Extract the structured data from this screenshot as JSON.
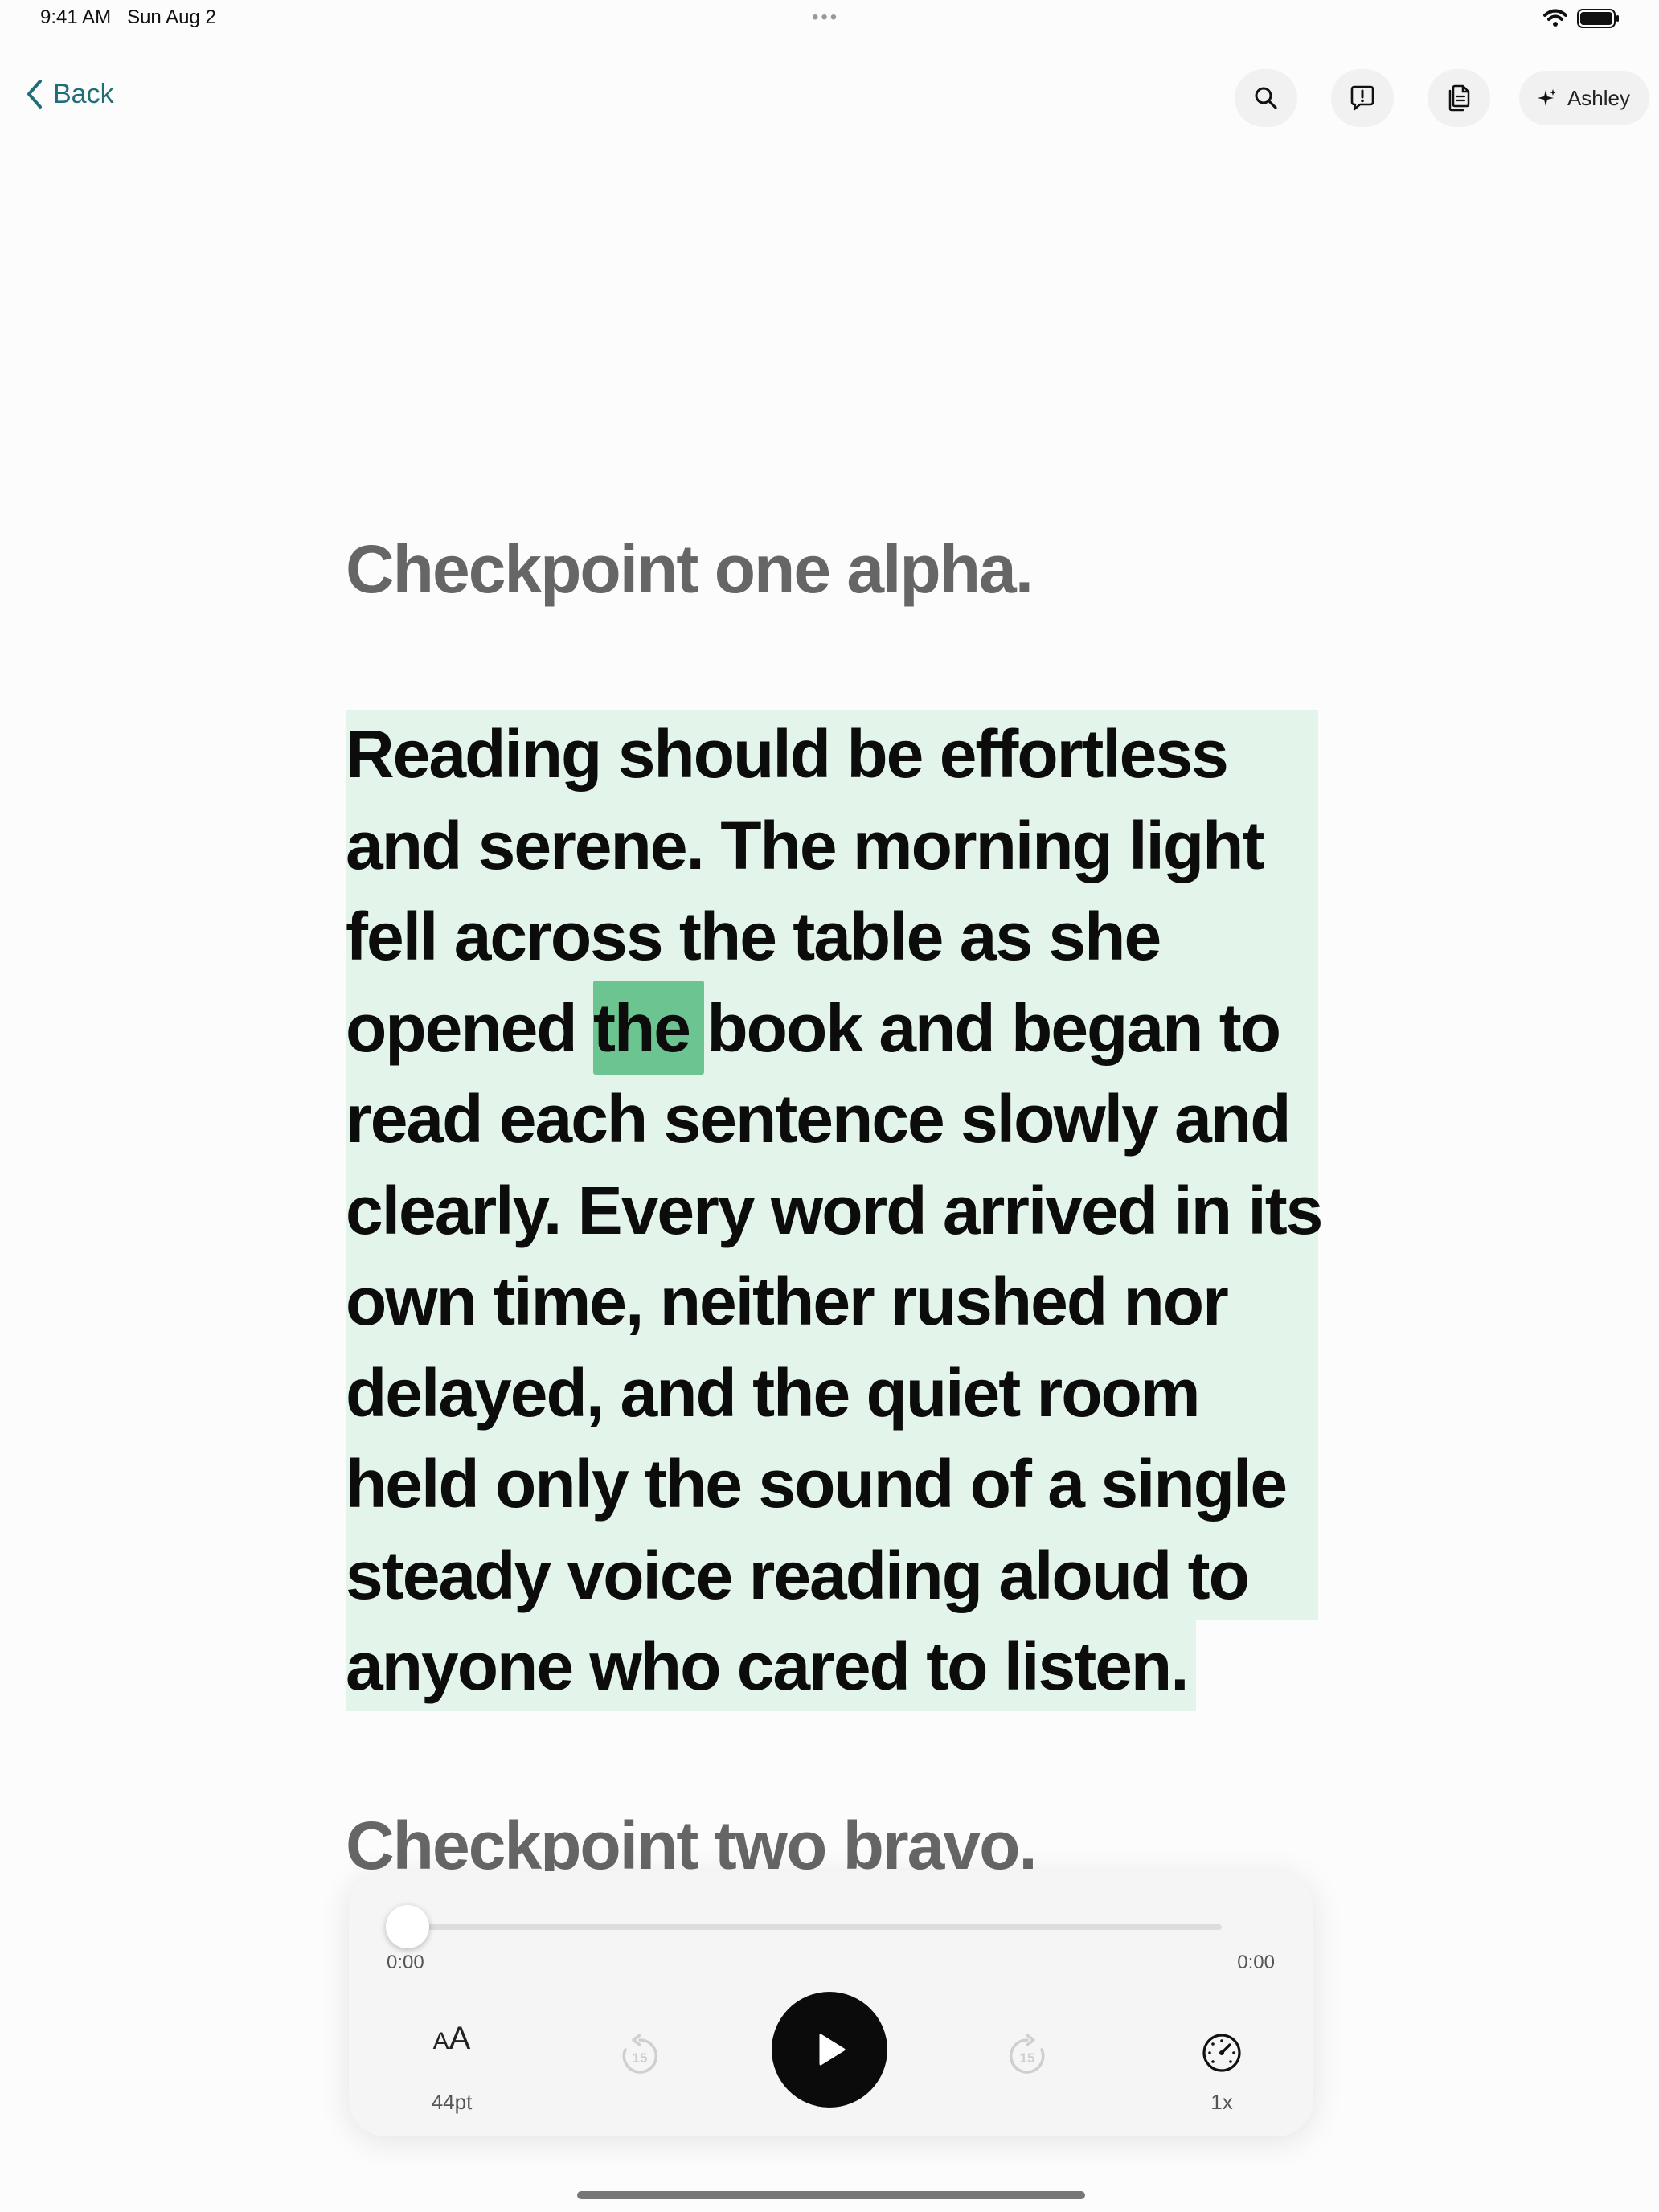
{
  "status_bar": {
    "time": "9:41 AM",
    "date": "Sun Aug 2",
    "multitasking": "•••"
  },
  "nav": {
    "back_label": "Back"
  },
  "toolbar": {
    "icons": [
      "search-icon",
      "feedback-icon",
      "documents-icon"
    ],
    "user_name": "Ashley"
  },
  "reader": {
    "heading_1": "Checkpoint one alpha.",
    "paragraph": "Reading should be effortless\nand serene. The morning light\nfell across the table as she\nopened the book and began to\nread each sentence slowly and\nclearly. Every word arrived in its\nown time, neither rushed nor\ndelayed, and the quiet room\nheld only the sound of a single\nsteady voice reading aloud to\nanyone who cared to listen.",
    "highlighted_word": "the",
    "heading_2": "Checkpoint two bravo."
  },
  "player": {
    "time_elapsed": "0:00",
    "time_total": "0:00",
    "progress": 0,
    "font_size_icon": "AA",
    "font_size_label": "44pt",
    "skip_back_seconds": "15",
    "skip_forward_seconds": "15",
    "speed_label": "1x"
  },
  "colors": {
    "accent": "#1f6e7a",
    "paragraph_highlight": "#e3f4ea",
    "word_highlight": "#6cc590"
  }
}
